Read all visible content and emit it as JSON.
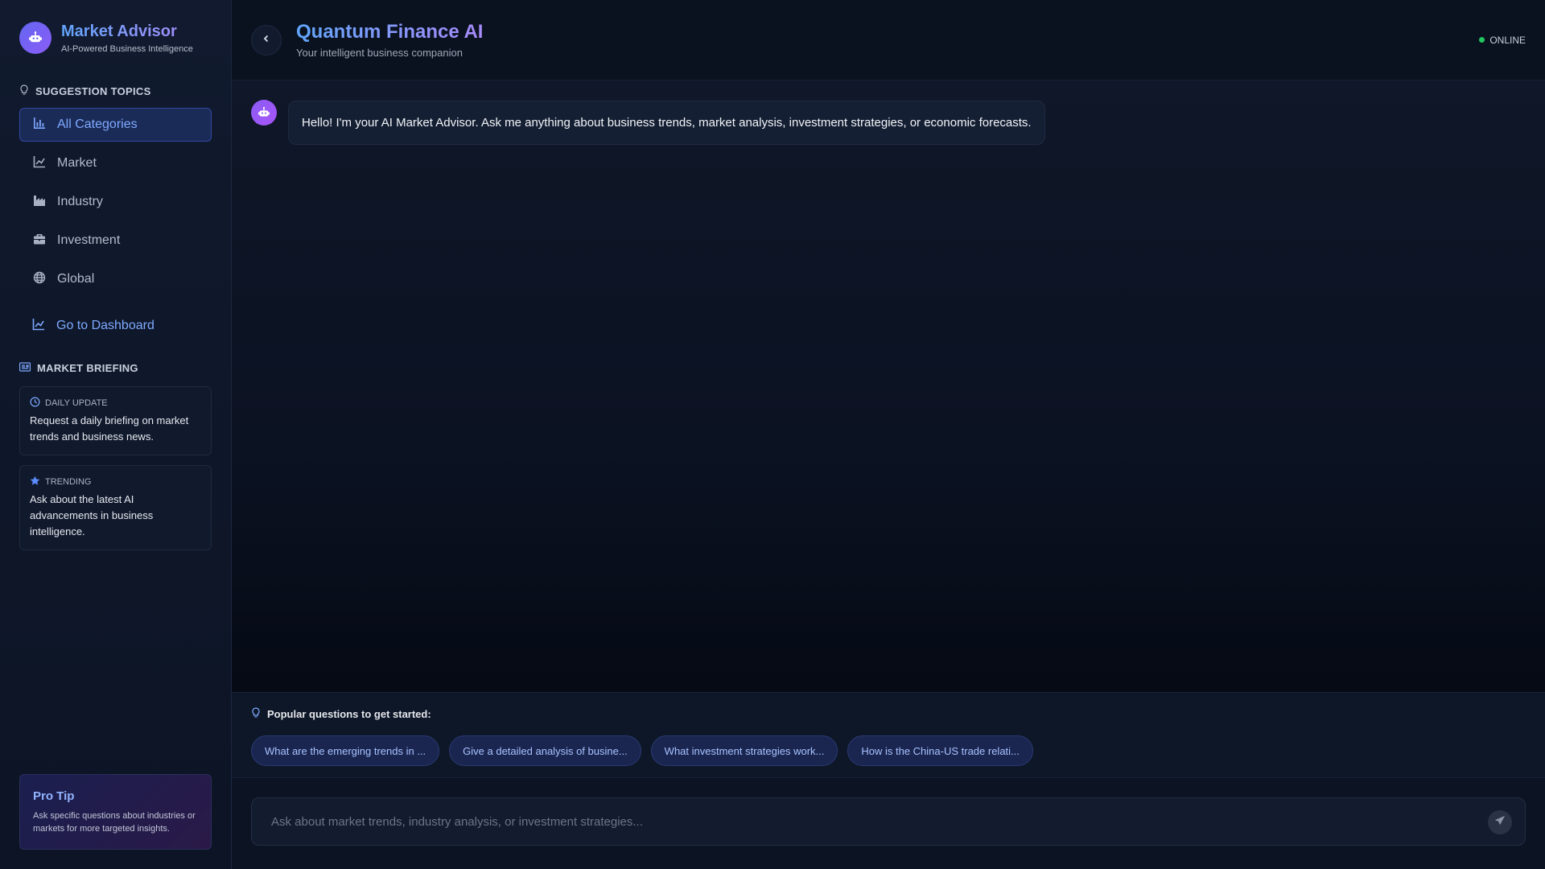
{
  "sidebar": {
    "brand_title": "Market Advisor",
    "brand_subtitle": "AI-Powered Business Intelligence",
    "topics_heading": "SUGGESTION TOPICS",
    "items": [
      {
        "label": "All Categories",
        "icon": "bar-chart-icon",
        "active": true
      },
      {
        "label": "Market",
        "icon": "line-chart-icon",
        "active": false
      },
      {
        "label": "Industry",
        "icon": "factory-icon",
        "active": false
      },
      {
        "label": "Investment",
        "icon": "briefcase-icon",
        "active": false
      },
      {
        "label": "Global",
        "icon": "globe-icon",
        "active": false
      }
    ],
    "dashboard_link": "Go to Dashboard",
    "briefing_heading": "MARKET BRIEFING",
    "briefing_cards": [
      {
        "tag": "DAILY UPDATE",
        "icon": "clock-icon",
        "text": "Request a daily briefing on market trends and business news."
      },
      {
        "tag": "TRENDING",
        "icon": "star-icon",
        "text": "Ask about the latest AI advancements in business intelligence."
      }
    ],
    "protip": {
      "title": "Pro Tip",
      "text": "Ask specific questions about industries or markets for more targeted insights."
    }
  },
  "header": {
    "title": "Quantum Finance AI",
    "subtitle": "Your intelligent business companion",
    "status": "ONLINE"
  },
  "chat": {
    "messages": [
      {
        "role": "assistant",
        "text": "Hello! I'm your AI Market Advisor. Ask me anything about business trends, market analysis, investment strategies, or economic forecasts."
      }
    ]
  },
  "suggestions": {
    "heading": "Popular questions to get started:",
    "chips": [
      "What are the emerging trends in ...",
      "Give a detailed analysis of busine...",
      "What investment strategies work...",
      "How is the China-US trade relati..."
    ]
  },
  "composer": {
    "placeholder": "Ask about market trends, industry analysis, or investment strategies..."
  },
  "colors": {
    "accent_blue": "#60a5fa",
    "accent_purple": "#a78bfa",
    "online": "#22c55e"
  }
}
